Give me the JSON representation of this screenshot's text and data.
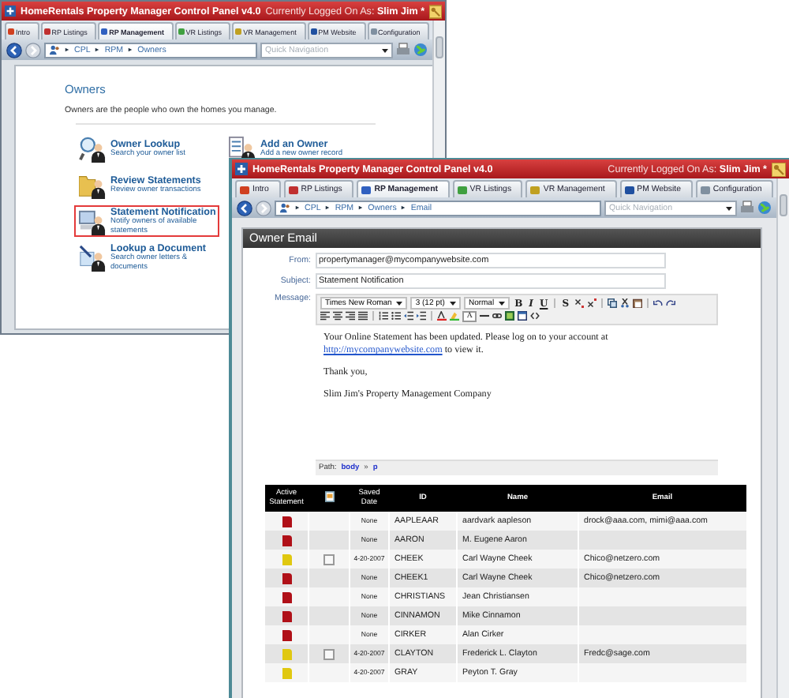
{
  "windows": [
    {
      "kind": "owners",
      "title": "HomeRentals Property Manager Control Panel v4.0",
      "status_label": "Currently Logged On As:",
      "user": "Slim Jim *",
      "tabs": [
        {
          "label": "Intro",
          "selected": false
        },
        {
          "label": "RP Listings",
          "selected": false
        },
        {
          "label": "RP Management",
          "selected": true
        },
        {
          "label": "VR Listings",
          "selected": false
        },
        {
          "label": "VR Management",
          "selected": false
        },
        {
          "label": "PM Website",
          "selected": false
        },
        {
          "label": "Configuration",
          "selected": false
        }
      ],
      "breadcrumb": [
        "CPL",
        "RPM",
        "Owners"
      ],
      "quick_nav": {
        "placeholder": "Quick Navigation"
      },
      "heading": "Owners",
      "description": "Owners are the people who own the homes you manage.",
      "action_rows": [
        [
          {
            "kind": "lookup",
            "title": "Owner Lookup",
            "subtitle": "Search your owner list",
            "selected": false
          },
          {
            "kind": "add",
            "title": "Add an Owner",
            "subtitle": "Add a new owner record",
            "selected": false
          }
        ],
        [
          {
            "kind": "review",
            "title": "Review Statements",
            "subtitle": "Review owner transactions",
            "selected": false
          }
        ],
        [
          {
            "kind": "notify",
            "title": "Statement Notification",
            "subtitle": "Notify owners of available statements",
            "selected": true
          }
        ],
        [
          {
            "kind": "document",
            "title": "Lookup a Document",
            "subtitle": "Search owner letters & documents",
            "selected": false
          }
        ]
      ]
    },
    {
      "kind": "email",
      "title": "HomeRentals Property Manager Control Panel v4.0",
      "status_label": "Currently Logged On As:",
      "user": "Slim Jim *",
      "tabs": [
        {
          "label": "Intro",
          "selected": false
        },
        {
          "label": "RP Listings",
          "selected": false
        },
        {
          "label": "RP Management",
          "selected": true
        },
        {
          "label": "VR Listings",
          "selected": false
        },
        {
          "label": "VR Management",
          "selected": false
        },
        {
          "label": "PM Website",
          "selected": false
        },
        {
          "label": "Configuration",
          "selected": false
        }
      ],
      "breadcrumb": [
        "CPL",
        "RPM",
        "Owners",
        "Email"
      ],
      "quick_nav": {
        "placeholder": "Quick Navigation"
      },
      "panel_title": "Owner Email",
      "fields": [
        {
          "label": "From:",
          "value": "propertymanager@mycompanywebsite.com"
        },
        {
          "label": "Subject:",
          "value": "Statement Notification"
        }
      ],
      "message_label": "Message:",
      "toolbar": [
        [
          {
            "kind": "select",
            "value": "Times New Roman"
          },
          {
            "kind": "select",
            "value": "3 (12 pt)"
          },
          {
            "kind": "select",
            "value": "Normal"
          },
          {
            "kind": "bold",
            "label": "B"
          },
          {
            "kind": "italic",
            "label": "I"
          },
          {
            "kind": "underline",
            "label": "U"
          },
          {
            "kind": "sep"
          },
          {
            "kind": "strike",
            "label": "S"
          },
          {
            "kind": "sub"
          },
          {
            "kind": "sup"
          },
          {
            "kind": "sep"
          },
          {
            "kind": "copy"
          },
          {
            "kind": "cut"
          },
          {
            "kind": "paste"
          },
          {
            "kind": "sep"
          },
          {
            "kind": "undo"
          },
          {
            "kind": "redo"
          }
        ],
        [
          {
            "kind": "align-left"
          },
          {
            "kind": "align-center"
          },
          {
            "kind": "align-right"
          },
          {
            "kind": "justify"
          },
          {
            "kind": "sep"
          },
          {
            "kind": "ol"
          },
          {
            "kind": "ul"
          },
          {
            "kind": "outdent"
          },
          {
            "kind": "indent"
          },
          {
            "kind": "sep"
          },
          {
            "kind": "fore"
          },
          {
            "kind": "back"
          },
          {
            "kind": "box",
            "label": "A"
          },
          {
            "kind": "hr"
          },
          {
            "kind": "link"
          },
          {
            "kind": "image"
          },
          {
            "kind": "table"
          },
          {
            "kind": "code"
          }
        ]
      ],
      "body": [
        {
          "text": "Your Online Statement has been updated.  Please log on to your account at",
          "link": "http://mycompanywebsite.com",
          "after": " to view it."
        },
        {
          "text": "Thank you,"
        },
        {
          "text": "Slim Jim's Property Management Company"
        }
      ],
      "path": {
        "label": "Path:",
        "items": [
          "body",
          "p"
        ],
        "separator": "»"
      },
      "table": {
        "columns": [
          {
            "kind": "text",
            "label": "Active Statement"
          },
          {
            "kind": "icon"
          },
          {
            "kind": "text",
            "label": "Saved Date"
          },
          {
            "kind": "text",
            "label": "ID"
          },
          {
            "kind": "text",
            "label": "Name"
          },
          {
            "kind": "text",
            "label": "Email"
          }
        ],
        "rows": [
          {
            "color": "#b01018",
            "saved": "None",
            "id": "AAPLEAAR",
            "name": "aardvark aapleson",
            "email": "drock@aaa.com, mimi@aaa.com"
          },
          {
            "color": "#b01018",
            "saved": "None",
            "id": "AARON",
            "name": "M. Eugene Aaron"
          },
          {
            "color": "#e0c810",
            "checkbox": {
              "checked": false
            },
            "saved": "4-20-2007",
            "id": "CHEEK",
            "name": "Carl Wayne Cheek",
            "email": "Chico@netzero.com"
          },
          {
            "color": "#b01018",
            "saved": "None",
            "id": "CHEEK1",
            "name": "Carl Wayne Cheek",
            "email": "Chico@netzero.com"
          },
          {
            "color": "#b01018",
            "saved": "None",
            "id": "CHRISTIANS",
            "name": "Jean Christiansen"
          },
          {
            "color": "#b01018",
            "saved": "None",
            "id": "CINNAMON",
            "name": "Mike Cinnamon"
          },
          {
            "color": "#b01018",
            "saved": "None",
            "id": "CIRKER",
            "name": "Alan Cirker"
          },
          {
            "color": "#e0c810",
            "checkbox": {
              "checked": false
            },
            "saved": "4-20-2007",
            "id": "CLAYTON",
            "name": "Frederick L. Clayton",
            "email": "Fredc@sage.com"
          },
          {
            "color": "#e0c810",
            "saved": "4-20-2007",
            "id": "GRAY",
            "name": "Peyton T. Gray"
          }
        ]
      }
    }
  ]
}
